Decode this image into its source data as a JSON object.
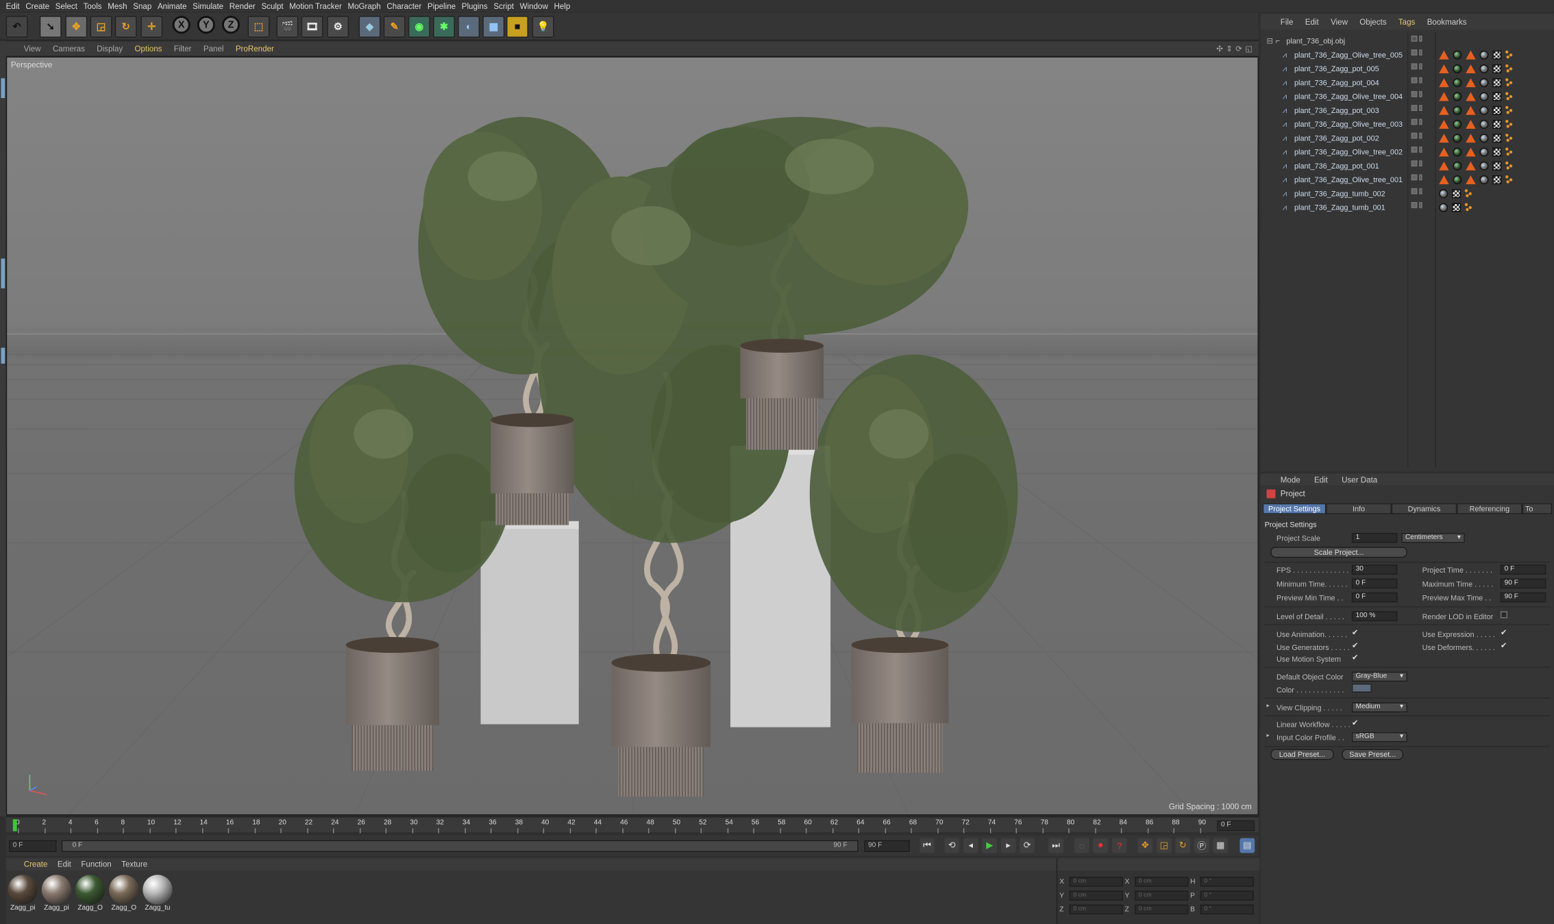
{
  "menubar": [
    "Edit",
    "Create",
    "Select",
    "Tools",
    "Mesh",
    "Snap",
    "Animate",
    "Simulate",
    "Render",
    "Sculpt",
    "Motion Tracker",
    "MoGraph",
    "Character",
    "Pipeline",
    "Plugins",
    "Script",
    "Window",
    "Help"
  ],
  "toolbar": {
    "icons": [
      "undo-icon",
      "select-arrow-icon",
      "move-icon",
      "scale-icon",
      "rotate-icon",
      "live-select-icon",
      "x-axis-lock",
      "y-axis-lock",
      "z-axis-lock",
      "world-coordinates-icon",
      "render-view-icon",
      "render-picture-viewer-icon",
      "edit-render-settings-icon",
      "cube-icon",
      "pen-icon",
      "subdivision-icon",
      "cloner-icon",
      "deformer-icon",
      "floor-icon",
      "camera-icon",
      "light-icon"
    ],
    "axis_labels": [
      "X",
      "Y",
      "Z"
    ]
  },
  "viewport": {
    "menu": [
      "View",
      "Cameras",
      "Display",
      "Options",
      "Filter",
      "Panel",
      "ProRender"
    ],
    "label": "Perspective",
    "grid_spacing": "Grid Spacing : 1000 cm"
  },
  "timeline": {
    "ticks": [
      "0",
      "2",
      "4",
      "6",
      "8",
      "10",
      "12",
      "14",
      "16",
      "18",
      "20",
      "22",
      "24",
      "26",
      "28",
      "30",
      "32",
      "34",
      "36",
      "38",
      "40",
      "42",
      "44",
      "46",
      "48",
      "50",
      "52",
      "54",
      "56",
      "58",
      "60",
      "62",
      "64",
      "66",
      "68",
      "70",
      "72",
      "74",
      "76",
      "78",
      "80",
      "82",
      "84",
      "86",
      "88",
      "90"
    ],
    "end_field": "0 F",
    "current_frame": "0 F",
    "range_start": "0 F",
    "range_end": "90 F",
    "max_field": "90 F"
  },
  "materials": {
    "menu": [
      "Create",
      "Edit",
      "Function",
      "Texture"
    ],
    "items": [
      {
        "label": "Zagg_pi",
        "color": "#5a4a3c"
      },
      {
        "label": "Zagg_pi",
        "color": "#8a7a70"
      },
      {
        "label": "Zagg_O",
        "color": "#3c5a32"
      },
      {
        "label": "Zagg_O",
        "color": "#7a6a58"
      },
      {
        "label": "Zagg_tu",
        "color": "#b8b8b8"
      }
    ]
  },
  "coordinates": {
    "rows": [
      {
        "a": "X",
        "av": "0 cm",
        "b": "X",
        "bv": "0 cm",
        "c": "H",
        "cv": "0 °"
      },
      {
        "a": "Y",
        "av": "0 cm",
        "b": "Y",
        "bv": "0 cm",
        "c": "P",
        "cv": "0 °"
      },
      {
        "a": "Z",
        "av": "0 cm",
        "b": "Z",
        "bv": "0 cm",
        "c": "B",
        "cv": "0 °"
      }
    ]
  },
  "object_manager": {
    "menu": [
      "File",
      "Edit",
      "View",
      "Objects",
      "Tags",
      "Bookmarks"
    ],
    "root": "plant_736_obj.obj",
    "objects": [
      {
        "name": "plant_736_Zagg_Olive_tree_005",
        "tags": "full"
      },
      {
        "name": "plant_736_Zagg_pot_005",
        "tags": "full"
      },
      {
        "name": "plant_736_Zagg_pot_004",
        "tags": "full"
      },
      {
        "name": "plant_736_Zagg_Olive_tree_004",
        "tags": "full"
      },
      {
        "name": "plant_736_Zagg_pot_003",
        "tags": "full"
      },
      {
        "name": "plant_736_Zagg_Olive_tree_003",
        "tags": "full"
      },
      {
        "name": "plant_736_Zagg_pot_002",
        "tags": "full"
      },
      {
        "name": "plant_736_Zagg_Olive_tree_002",
        "tags": "full"
      },
      {
        "name": "plant_736_Zagg_pot_001",
        "tags": "full"
      },
      {
        "name": "plant_736_Zagg_Olive_tree_001",
        "tags": "full"
      },
      {
        "name": "plant_736_Zagg_tumb_002",
        "tags": "short"
      },
      {
        "name": "plant_736_Zagg_tumb_001",
        "tags": "short"
      }
    ]
  },
  "attributes": {
    "menu": [
      "Mode",
      "Edit",
      "User Data"
    ],
    "title": "Project",
    "tabs": [
      "Project Settings",
      "Info",
      "Dynamics",
      "Referencing",
      "To"
    ],
    "section": "Project Settings",
    "project_scale_label": "Project Scale",
    "project_scale_value": "1",
    "project_scale_unit": "Centimeters",
    "scale_button": "Scale Project...",
    "fps_label": "FPS . . . . . . . . . . . . . .",
    "fps_value": "30",
    "project_time_label": "Project Time . . . . . . .",
    "project_time_value": "0 F",
    "min_time_label": "Minimum Time. . . . . .",
    "min_time_value": "0 F",
    "max_time_label": "Maximum Time . . . . .",
    "max_time_value": "90 F",
    "prev_min_label": "Preview Min Time . .",
    "prev_min_value": "0 F",
    "prev_max_label": "Preview Max Time . .",
    "prev_max_value": "90 F",
    "lod_label": "Level of Detail . . . . .",
    "lod_value": "100 %",
    "render_lod_label": "Render LOD in Editor",
    "use_animation": "Use Animation. . . . . .",
    "use_expression": "Use Expression . . . . .",
    "use_generators": "Use Generators . . . . .",
    "use_deformers": "Use Deformers. . . . . .",
    "use_motion": "Use Motion System",
    "default_color_label": "Default Object Color",
    "default_color_value": "Gray-Blue",
    "color_label": "Color . . . . . . . . . . . .",
    "view_clipping_label": "View Clipping . . . . .",
    "view_clipping_value": "Medium",
    "linear_workflow": "Linear Workflow . . . . .",
    "input_profile_label": "Input Color Profile . .",
    "input_profile_value": "sRGB",
    "load_preset": "Load Preset...",
    "save_preset": "Save Preset..."
  },
  "colors": {
    "accent": "#e8c86a",
    "tab_active": "#5577aa",
    "object_name": "#cde",
    "tag_triangle": "#e76020"
  }
}
